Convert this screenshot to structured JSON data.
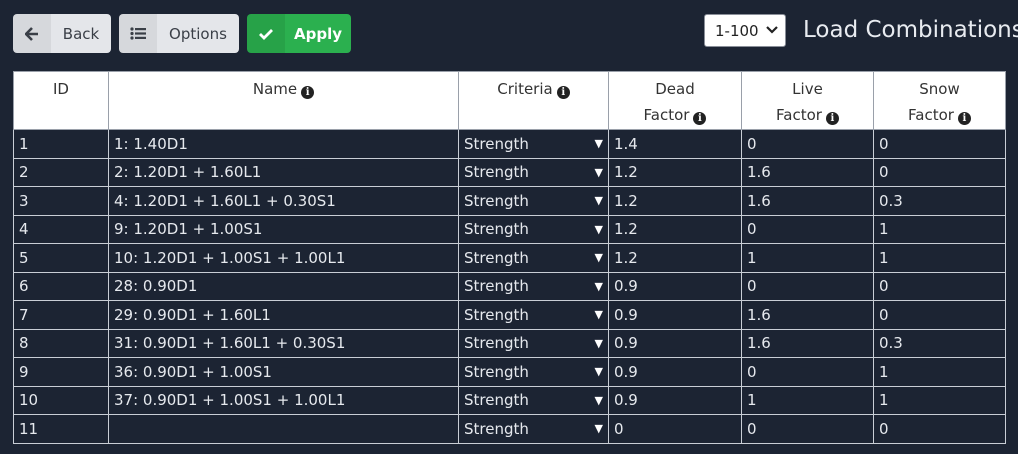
{
  "toolbar": {
    "back_label": "Back",
    "options_label": "Options",
    "apply_label": "Apply",
    "range_value": "1-100",
    "title": "Load Combinations"
  },
  "colors": {
    "apply_green": "#2bb04f",
    "background": "#1c2433",
    "header_bg": "#ffffff"
  },
  "table": {
    "headers": {
      "id": "ID",
      "name": "Name",
      "criteria": "Criteria",
      "dead_1": "Dead",
      "dead_2": "Factor",
      "live_1": "Live",
      "live_2": "Factor",
      "snow_1": "Snow",
      "snow_2": "Factor"
    },
    "rows": [
      {
        "id": "1",
        "name": "1: 1.40D1",
        "criteria": "Strength",
        "dead": "1.4",
        "live": "0",
        "snow": "0"
      },
      {
        "id": "2",
        "name": "2: 1.20D1 + 1.60L1",
        "criteria": "Strength",
        "dead": "1.2",
        "live": "1.6",
        "snow": "0"
      },
      {
        "id": "3",
        "name": "4: 1.20D1 + 1.60L1 + 0.30S1",
        "criteria": "Strength",
        "dead": "1.2",
        "live": "1.6",
        "snow": "0.3"
      },
      {
        "id": "4",
        "name": "9: 1.20D1 + 1.00S1",
        "criteria": "Strength",
        "dead": "1.2",
        "live": "0",
        "snow": "1"
      },
      {
        "id": "5",
        "name": "10: 1.20D1 + 1.00S1 + 1.00L1",
        "criteria": "Strength",
        "dead": "1.2",
        "live": "1",
        "snow": "1"
      },
      {
        "id": "6",
        "name": "28: 0.90D1",
        "criteria": "Strength",
        "dead": "0.9",
        "live": "0",
        "snow": "0"
      },
      {
        "id": "7",
        "name": "29: 0.90D1 + 1.60L1",
        "criteria": "Strength",
        "dead": "0.9",
        "live": "1.6",
        "snow": "0"
      },
      {
        "id": "8",
        "name": "31: 0.90D1 + 1.60L1 + 0.30S1",
        "criteria": "Strength",
        "dead": "0.9",
        "live": "1.6",
        "snow": "0.3"
      },
      {
        "id": "9",
        "name": "36: 0.90D1 + 1.00S1",
        "criteria": "Strength",
        "dead": "0.9",
        "live": "0",
        "snow": "1"
      },
      {
        "id": "10",
        "name": "37: 0.90D1 + 1.00S1 + 1.00L1",
        "criteria": "Strength",
        "dead": "0.9",
        "live": "1",
        "snow": "1"
      },
      {
        "id": "11",
        "name": "",
        "criteria": "Strength",
        "dead": "0",
        "live": "0",
        "snow": "0"
      }
    ]
  }
}
